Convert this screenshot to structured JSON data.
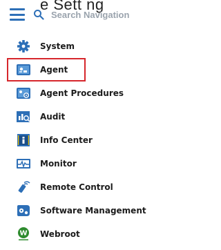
{
  "top_fragment": "e Sett ng",
  "search": {
    "placeholder": "Search Navigation"
  },
  "nav": {
    "items": [
      {
        "label": "System",
        "icon": "gear-icon"
      },
      {
        "label": "Agent",
        "icon": "agent-icon",
        "active": true
      },
      {
        "label": "Agent Procedures",
        "icon": "agent-procedures-icon"
      },
      {
        "label": "Audit",
        "icon": "audit-icon"
      },
      {
        "label": "Info Center",
        "icon": "info-center-icon"
      },
      {
        "label": "Monitor",
        "icon": "monitor-icon"
      },
      {
        "label": "Remote Control",
        "icon": "remote-control-icon"
      },
      {
        "label": "Software Management",
        "icon": "software-management-icon"
      },
      {
        "label": "Webroot",
        "icon": "webroot-icon"
      }
    ]
  },
  "colors": {
    "accent": "#2d6fb7",
    "selection_outline": "#d6262b",
    "webroot_green": "#2e8b2e"
  }
}
